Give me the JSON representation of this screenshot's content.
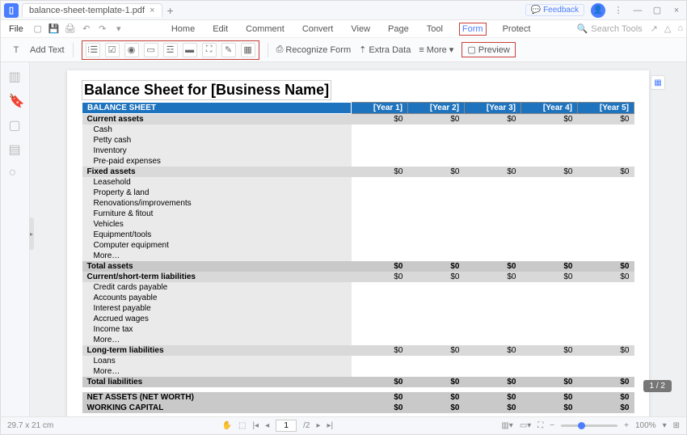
{
  "app": {
    "tab_title": "balance-sheet-template-1.pdf"
  },
  "header": {
    "feedback": "Feedback",
    "file": "File",
    "menu": [
      "Home",
      "Edit",
      "Comment",
      "Convert",
      "View",
      "Page",
      "Tool"
    ],
    "menu_form": "Form",
    "menu_protect": "Protect",
    "search_placeholder": "Search Tools"
  },
  "toolbar": {
    "add_text": "Add Text",
    "recognize": "Recognize Form",
    "extra_data": "Extra Data",
    "more": "More",
    "preview": "Preview"
  },
  "doc": {
    "title": "Balance Sheet for [Business Name]",
    "header_label": "BALANCE SHEET",
    "years": [
      "[Year 1]",
      "[Year 2]",
      "[Year 3]",
      "[Year 4]",
      "[Year 5]"
    ],
    "sections": [
      {
        "kind": "head",
        "label": "Current assets",
        "vals": [
          "$0",
          "$0",
          "$0",
          "$0",
          "$0"
        ]
      },
      {
        "kind": "item",
        "label": "Cash"
      },
      {
        "kind": "item",
        "label": "Petty cash"
      },
      {
        "kind": "item",
        "label": "Inventory"
      },
      {
        "kind": "item",
        "label": "Pre-paid expenses"
      },
      {
        "kind": "head",
        "label": "Fixed assets",
        "vals": [
          "$0",
          "$0",
          "$0",
          "$0",
          "$0"
        ]
      },
      {
        "kind": "item",
        "label": "Leasehold"
      },
      {
        "kind": "item",
        "label": "Property & land"
      },
      {
        "kind": "item",
        "label": "Renovations/improvements"
      },
      {
        "kind": "item",
        "label": "Furniture & fitout"
      },
      {
        "kind": "item",
        "label": "Vehicles"
      },
      {
        "kind": "item",
        "label": "Equipment/tools"
      },
      {
        "kind": "item",
        "label": "Computer equipment"
      },
      {
        "kind": "item",
        "label": "More…"
      },
      {
        "kind": "total",
        "label": "Total assets",
        "vals": [
          "$0",
          "$0",
          "$0",
          "$0",
          "$0"
        ]
      },
      {
        "kind": "head",
        "label": "Current/short-term liabilities",
        "vals": [
          "$0",
          "$0",
          "$0",
          "$0",
          "$0"
        ]
      },
      {
        "kind": "item",
        "label": "Credit cards payable"
      },
      {
        "kind": "item",
        "label": "Accounts payable"
      },
      {
        "kind": "item",
        "label": "Interest payable"
      },
      {
        "kind": "item",
        "label": "Accrued wages"
      },
      {
        "kind": "item",
        "label": "Income tax"
      },
      {
        "kind": "item",
        "label": "More…"
      },
      {
        "kind": "head",
        "label": "Long-term liabilities",
        "vals": [
          "$0",
          "$0",
          "$0",
          "$0",
          "$0"
        ]
      },
      {
        "kind": "item",
        "label": "Loans"
      },
      {
        "kind": "item",
        "label": "More…"
      },
      {
        "kind": "total",
        "label": "Total liabilities",
        "vals": [
          "$0",
          "$0",
          "$0",
          "$0",
          "$0"
        ]
      },
      {
        "kind": "gap"
      },
      {
        "kind": "net",
        "label": "NET ASSETS (NET WORTH)",
        "vals": [
          "$0",
          "$0",
          "$0",
          "$0",
          "$0"
        ]
      },
      {
        "kind": "net",
        "label": "WORKING CAPITAL",
        "vals": [
          "$0",
          "$0",
          "$0",
          "$0",
          "$0"
        ]
      }
    ]
  },
  "status": {
    "dims": "29.7 x 21 cm",
    "page": "1",
    "pages": "/2",
    "zoom": "100%",
    "pagebadge": "1 / 2"
  }
}
